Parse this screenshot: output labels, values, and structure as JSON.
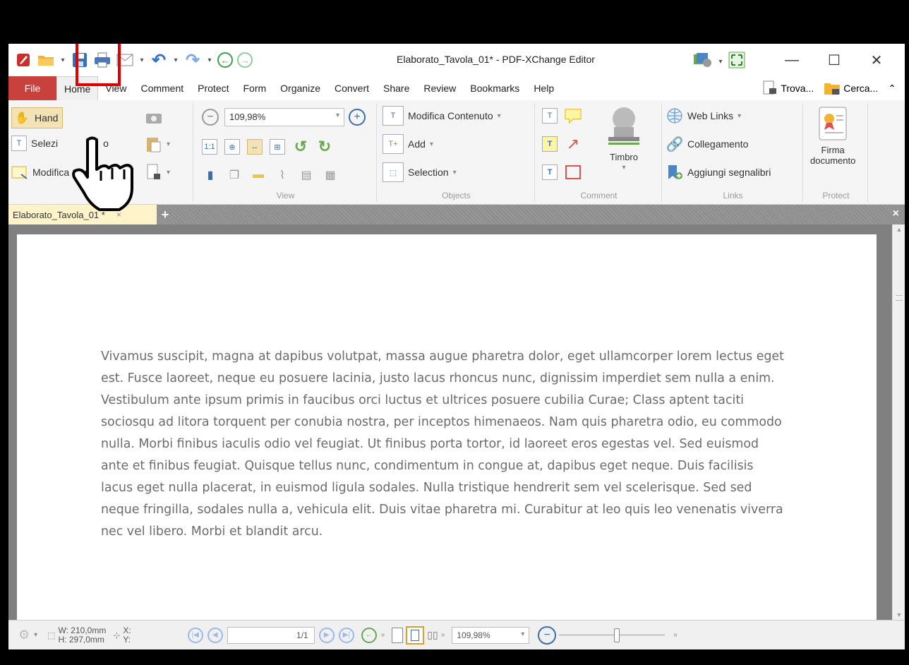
{
  "window": {
    "title": "Elaborato_Tavola_01* - PDF-XChange Editor"
  },
  "quick_access": {
    "icons": [
      "app-logo-icon",
      "open-folder-icon",
      "save-icon",
      "print-icon",
      "email-icon",
      "undo-icon",
      "redo-icon",
      "back-icon",
      "forward-icon"
    ]
  },
  "menu": {
    "file": "File",
    "items": [
      "Home",
      "View",
      "Comment",
      "Protect",
      "Form",
      "Organize",
      "Convert",
      "Share",
      "Review",
      "Bookmarks",
      "Help"
    ],
    "find": "Trova...",
    "search": "Cerca..."
  },
  "ribbon": {
    "tools": {
      "label": "Tools",
      "hand": "Hand",
      "select": "Selezi",
      "select_suffix": "o",
      "edit_comments": "Modifica Commenti"
    },
    "view": {
      "label": "View",
      "zoom": "109,98%"
    },
    "objects": {
      "label": "Objects",
      "edit_content": "Modifica Contenuto",
      "add": "Add",
      "selection": "Selection"
    },
    "comment": {
      "label": "Comment",
      "stamp": "Timbro"
    },
    "links": {
      "label": "Links",
      "web_links": "Web Links",
      "link": "Collegamento",
      "add_bookmarks": "Aggiungi segnalibri"
    },
    "protect": {
      "label": "Protect",
      "sign_line1": "Firma",
      "sign_line2": "documento"
    }
  },
  "doc_tab": {
    "name": "Elaborato_Tavola_01 *",
    "close": "×",
    "add": "+",
    "close_all": "×"
  },
  "document": {
    "body": "Vivamus suscipit, magna at dapibus volutpat, massa augue pharetra dolor, eget ullamcorper lorem lectus eget est. Fusce laoreet, neque eu posuere lacinia, justo lacus rhoncus nunc, dignissim imperdiet sem nulla a enim. Vestibulum ante ipsum primis in faucibus orci luctus et ultrices posuere cubilia Curae; Class aptent taciti sociosqu ad litora torquent per conubia nostra, per inceptos himenaeos. Nam quis pharetra odio, eu commodo nulla. Morbi finibus iaculis odio vel feugiat. Ut finibus porta tortor, id laoreet eros egestas vel. Sed euismod ante et finibus feugiat. Quisque tellus nunc, condimentum in congue at, dapibus eget neque. Duis facilisis lacus eget nulla placerat, in euismod ligula sodales. Nulla tristique hendrerit sem vel scelerisque. Sed sed neque fringilla, sodales nulla a, vehicula elit. Duis vitae pharetra mi. Curabitur at leo quis leo venenatis viverra nec vel libero. Morbi et blandit arcu."
  },
  "status": {
    "width": "W: 210,0mm",
    "height": "H: 297,0mm",
    "x": "X:",
    "y": "Y:",
    "page": "1/1",
    "zoom": "109,98%",
    "zoom_slider_level": 0.55
  },
  "colors": {
    "file_tab": "#c9413c",
    "highlight": "#e00000",
    "doc_tab": "#fff3c9",
    "text": "#6b6b6b"
  }
}
